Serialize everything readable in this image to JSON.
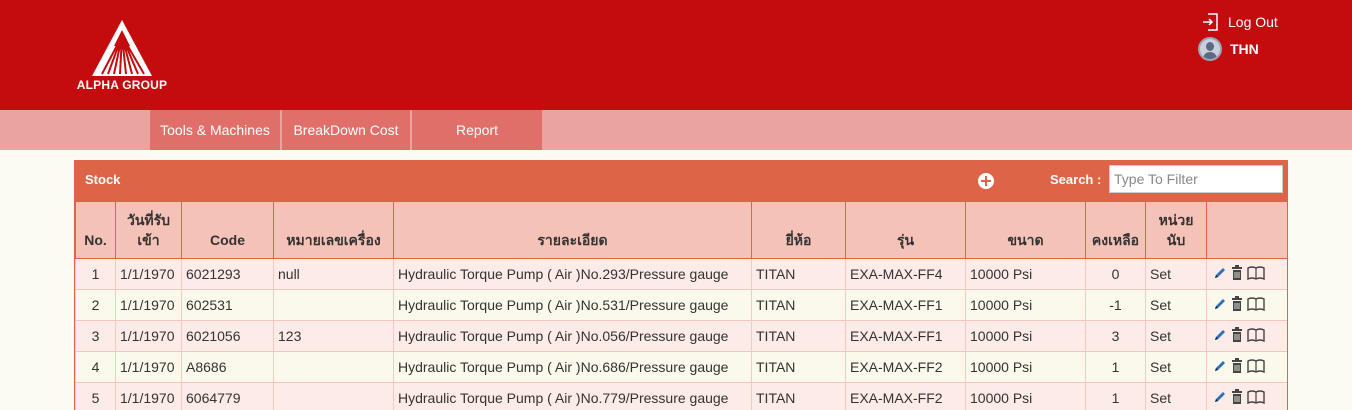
{
  "brand": {
    "logo_text": "ALPHA GROUP"
  },
  "header": {
    "logout_label": "Log Out",
    "user_name": "THN"
  },
  "nav": {
    "items": [
      "Tools & Machines",
      "BreakDown Cost",
      "Report"
    ]
  },
  "panel": {
    "title": "Stock",
    "search_label": "Search :",
    "search_placeholder": "Type To Filter"
  },
  "table": {
    "columns": [
      "No.",
      "วันที่รับเข้า",
      "Code",
      "หมายเลขเครื่อง",
      "รายละเอียด",
      "ยี่ห้อ",
      "รุ่น",
      "ขนาด",
      "คงเหลือ",
      "หน่วยนับ"
    ],
    "rows": [
      [
        "1",
        "1/1/1970",
        "6021293",
        "null",
        "Hydraulic Torque Pump ( Air )No.293/Pressure gauge",
        "TITAN",
        "EXA-MAX-FF4",
        "10000 Psi",
        "0",
        "Set"
      ],
      [
        "2",
        "1/1/1970",
        "602531",
        "",
        "Hydraulic Torque Pump ( Air )No.531/Pressure gauge",
        "TITAN",
        "EXA-MAX-FF1",
        "10000 Psi",
        "-1",
        "Set"
      ],
      [
        "3",
        "1/1/1970",
        "6021056",
        "123",
        "Hydraulic Torque Pump ( Air )No.056/Pressure gauge",
        "TITAN",
        "EXA-MAX-FF1",
        "10000 Psi",
        "3",
        "Set"
      ],
      [
        "4",
        "1/1/1970",
        "A8686",
        "",
        "Hydraulic Torque Pump ( Air )No.686/Pressure gauge",
        "TITAN",
        "EXA-MAX-FF2",
        "10000 Psi",
        "1",
        "Set"
      ],
      [
        "5",
        "1/1/1970",
        "6064779",
        "",
        "Hydraulic Torque Pump ( Air )No.779/Pressure gauge",
        "TITAN",
        "EXA-MAX-FF2",
        "10000 Psi",
        "1",
        "Set"
      ]
    ],
    "row_actions": [
      "edit-icon",
      "delete-icon",
      "view-icon"
    ]
  },
  "colors": {
    "header": "#c40b0e",
    "nav": "#eba39f",
    "nav_item": "#e06f6a",
    "panel_head": "#de6448",
    "table_head": "#f5c2b7",
    "row_odd": "#fcebe6",
    "row_even": "#fbf9ec"
  }
}
